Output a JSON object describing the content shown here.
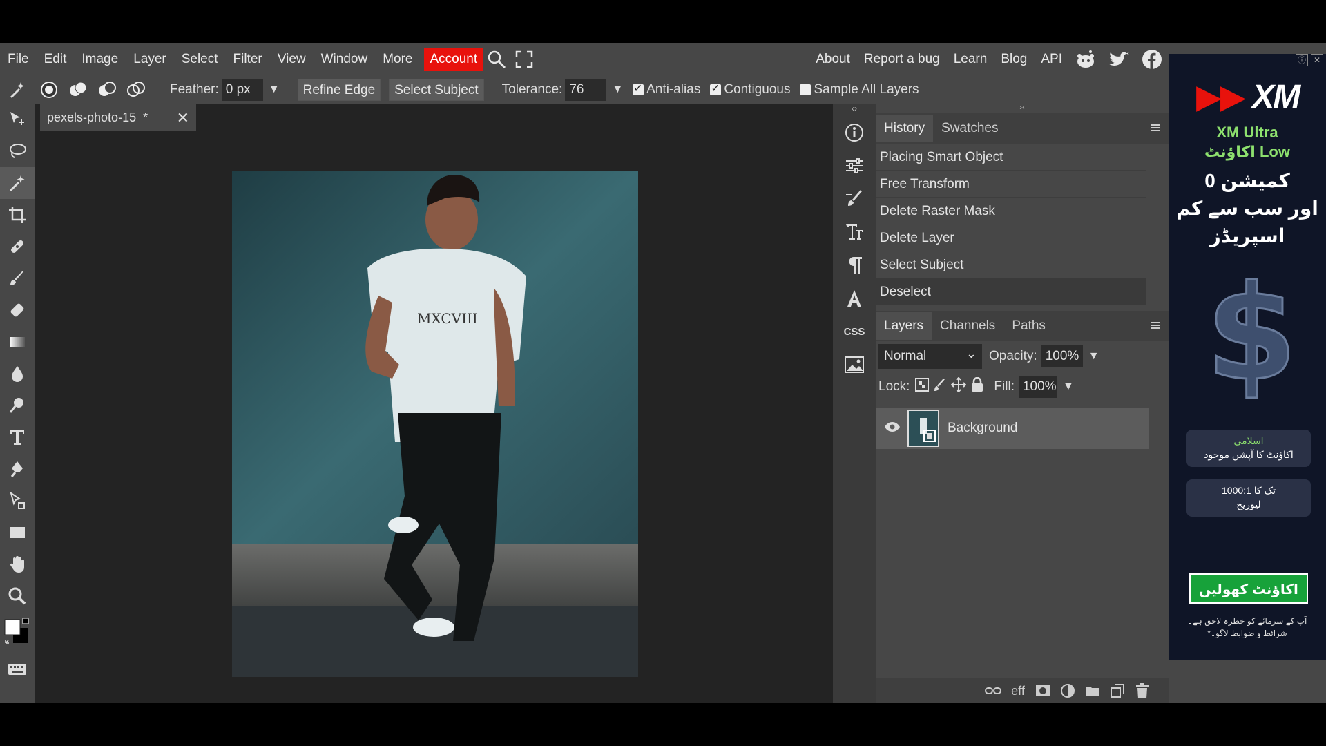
{
  "menubar": {
    "items": [
      "File",
      "Edit",
      "Image",
      "Layer",
      "Select",
      "Filter",
      "View",
      "Window",
      "More"
    ],
    "account": "Account",
    "right_items": [
      "About",
      "Report a bug",
      "Learn",
      "Blog",
      "API"
    ]
  },
  "options": {
    "feather_label": "Feather:",
    "feather_value": "0 px",
    "refine_edge": "Refine Edge",
    "select_subject": "Select Subject",
    "tolerance_label": "Tolerance:",
    "tolerance_value": "76",
    "anti_alias": "Anti-alias",
    "contiguous": "Contiguous",
    "sample_all_layers": "Sample All Layers"
  },
  "document": {
    "tab_title": "pexels-photo-15",
    "modified_mark": "*",
    "close": "✕"
  },
  "history_panel": {
    "tabs": [
      "History",
      "Swatches"
    ],
    "items": [
      "Placing Smart Object",
      "Free Transform",
      "Delete Raster Mask",
      "Delete Layer",
      "Select Subject",
      "Deselect"
    ]
  },
  "layers_panel": {
    "tabs": [
      "Layers",
      "Channels",
      "Paths"
    ],
    "blend_mode": "Normal",
    "opacity_label": "Opacity:",
    "opacity_value": "100%",
    "lock_label": "Lock:",
    "fill_label": "Fill:",
    "fill_value": "100%",
    "layers": [
      {
        "name": "Background"
      }
    ],
    "eff_label": "eff"
  },
  "icon_column": {
    "css_label": "CSS"
  },
  "ad": {
    "brand_mark": "XM",
    "title_line1": "XM Ultra",
    "title_line2": "اکاؤنٹ Low",
    "urdu_line1": "0 کمیشن",
    "urdu_line2": "اور سب سے کم",
    "urdu_line3": "اسپریڈز",
    "box1_line1": "اسلامی",
    "box1_line2": "اکاؤنٹ کا آپشن موجود",
    "box2_line1": "1000:1 تک کا",
    "box2_line2": "لیوریج",
    "cta": "اکاؤنٹ کھولیں",
    "foot_line1": "آپ کے سرمائے کو خطرہ لاحق ہے۔",
    "foot_line2": "*شرائط و ضوابط لاگو۔"
  }
}
